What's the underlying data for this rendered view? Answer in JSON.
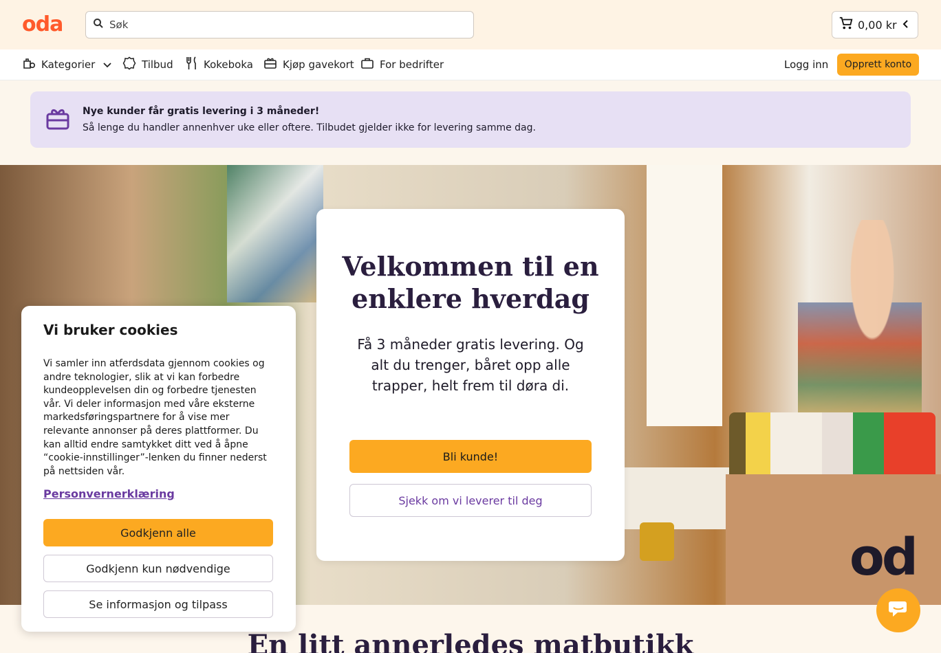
{
  "header": {
    "logo": "oda",
    "search_placeholder": "Søk",
    "cart_amount": "0,00 kr"
  },
  "nav": {
    "categories": "Kategorier",
    "offers": "Tilbud",
    "cookbook": "Kokeboka",
    "giftcard": "Kjøp gavekort",
    "business": "For bedrifter",
    "login": "Logg inn",
    "create_account": "Opprett konto"
  },
  "promo": {
    "title": "Nye kunder får gratis levering i 3 måneder!",
    "subtitle": "Så lenge du handler annenhver uke eller oftere. Tilbudet gjelder ikke for levering samme dag."
  },
  "hero": {
    "title_line1": "Velkommen til en",
    "title_line2": "enklere hverdag",
    "text": "Få 3 måneder gratis levering. Og alt du trenger, båret opp alle trapper, helt frem til døra di.",
    "primary_button": "Bli kunde!",
    "secondary_button": "Sjekk om vi leverer til deg",
    "box_logo": "od"
  },
  "section": {
    "heading": "En litt annerledes matbutikk"
  },
  "cookie": {
    "title": "Vi bruker cookies",
    "body": "Vi samler inn atferdsdata gjennom cookies og andre teknologier, slik at vi kan forbedre kundeopplevelsen din og forbedre tjenesten vår. Vi deler informasjon med våre eksterne markedsføringspartnere for å vise mer relevante annonser på deres plattformer. Du kan alltid endre samtykket ditt ved å åpne “cookie-innstillinger”-lenken du finner nederst på nettsiden vår.",
    "privacy_link": "Personvernerklæring",
    "accept_all": "Godkjenn alle",
    "accept_necessary": "Godkjenn kun nødvendige",
    "info_customize": "Se informasjon og tilpass"
  },
  "colors": {
    "accent": "#fca921",
    "brand": "#ff5a2b",
    "purple": "#6a3aa0",
    "promo_bg": "#e7e0f4"
  },
  "icons": [
    "search-icon",
    "cart-icon",
    "chevron-left-icon",
    "categories-icon",
    "chevron-down-icon",
    "offers-icon",
    "cookbook-icon",
    "giftcard-icon",
    "business-icon",
    "gift-icon",
    "chat-icon"
  ]
}
